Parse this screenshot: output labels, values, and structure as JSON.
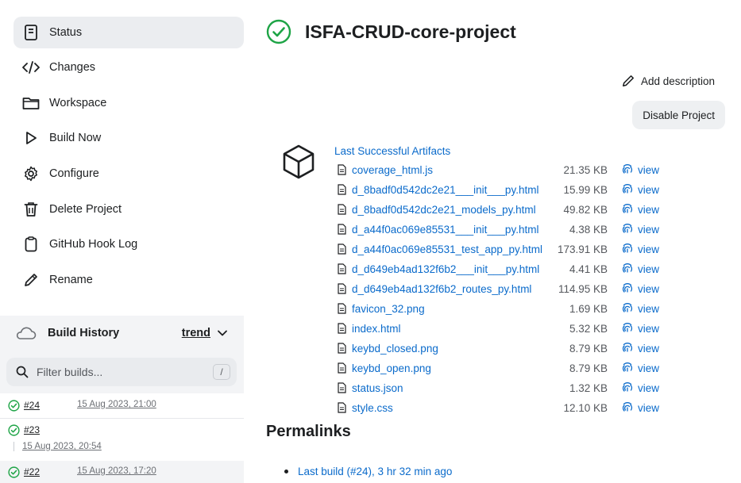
{
  "sidebar": {
    "items": [
      {
        "label": "Status",
        "icon": "status-icon"
      },
      {
        "label": "Changes",
        "icon": "code-icon"
      },
      {
        "label": "Workspace",
        "icon": "folder-icon"
      },
      {
        "label": "Build Now",
        "icon": "play-icon"
      },
      {
        "label": "Configure",
        "icon": "gear-icon"
      },
      {
        "label": "Delete Project",
        "icon": "trash-icon"
      },
      {
        "label": "GitHub Hook Log",
        "icon": "clipboard-icon"
      },
      {
        "label": "Rename",
        "icon": "pencil-icon"
      }
    ],
    "active": "Status"
  },
  "build_history": {
    "title": "Build History",
    "trend": "trend",
    "filter_placeholder": "Filter builds...",
    "filter_shortcut": "/",
    "builds": [
      {
        "number": "#24",
        "date": "15 Aug 2023, 21:00",
        "status": "success"
      },
      {
        "number": "#23",
        "date": "15 Aug 2023, 20:54",
        "status": "success"
      },
      {
        "number": "#22",
        "date": "15 Aug 2023, 17:20",
        "status": "success"
      }
    ]
  },
  "header": {
    "title": "ISFA-CRUD-core-project",
    "status": "success",
    "add_description": "Add description",
    "disable_project": "Disable Project"
  },
  "artifacts": {
    "heading": "Last Successful Artifacts",
    "view_label": "view",
    "files": [
      {
        "name": "coverage_html.js",
        "size": "21.35 KB"
      },
      {
        "name": "d_8badf0d542dc2e21___init___py.html",
        "size": "15.99 KB"
      },
      {
        "name": "d_8badf0d542dc2e21_models_py.html",
        "size": "49.82 KB"
      },
      {
        "name": "d_a44f0ac069e85531___init___py.html",
        "size": "4.38 KB"
      },
      {
        "name": "d_a44f0ac069e85531_test_app_py.html",
        "size": "173.91 KB"
      },
      {
        "name": "d_d649eb4ad132f6b2___init___py.html",
        "size": "4.41 KB"
      },
      {
        "name": "d_d649eb4ad132f6b2_routes_py.html",
        "size": "114.95 KB"
      },
      {
        "name": "favicon_32.png",
        "size": "1.69 KB"
      },
      {
        "name": "index.html",
        "size": "5.32 KB"
      },
      {
        "name": "keybd_closed.png",
        "size": "8.79 KB"
      },
      {
        "name": "keybd_open.png",
        "size": "8.79 KB"
      },
      {
        "name": "status.json",
        "size": "1.32 KB"
      },
      {
        "name": "style.css",
        "size": "12.10 KB"
      }
    ]
  },
  "permalinks": {
    "heading": "Permalinks",
    "items": [
      "Last build (#24), 3 hr 32 min ago"
    ]
  },
  "colors": {
    "accent": "#0b6bcb",
    "success": "#1ea446",
    "sidebar_active": "#ebedf0"
  }
}
